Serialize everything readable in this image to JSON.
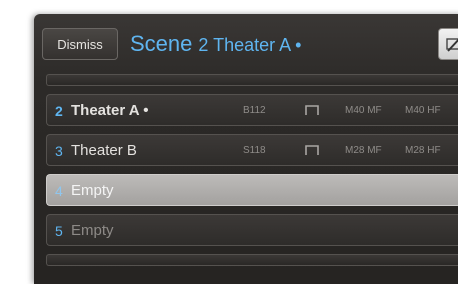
{
  "header": {
    "dismiss_label": "Dismiss",
    "scene_word": "Scene",
    "scene_name": "2 Theater A •",
    "corner_icon": "image-slash-icon"
  },
  "rows": [
    {
      "number": "2",
      "label": "Theater A •",
      "code": "B112",
      "icon": "bracket-icon",
      "value1": "M40 MF",
      "value2": "M40 HF"
    },
    {
      "number": "3",
      "label": "Theater B",
      "code": "S118",
      "icon": "bracket-icon",
      "value1": "M28 MF",
      "value2": "M28 HF"
    },
    {
      "number": "4",
      "label": "Empty"
    },
    {
      "number": "5",
      "label": "Empty"
    }
  ],
  "colors": {
    "accent": "#5fb5f0",
    "panel": "#2c2a28",
    "selected_row": "#b0aeac"
  }
}
